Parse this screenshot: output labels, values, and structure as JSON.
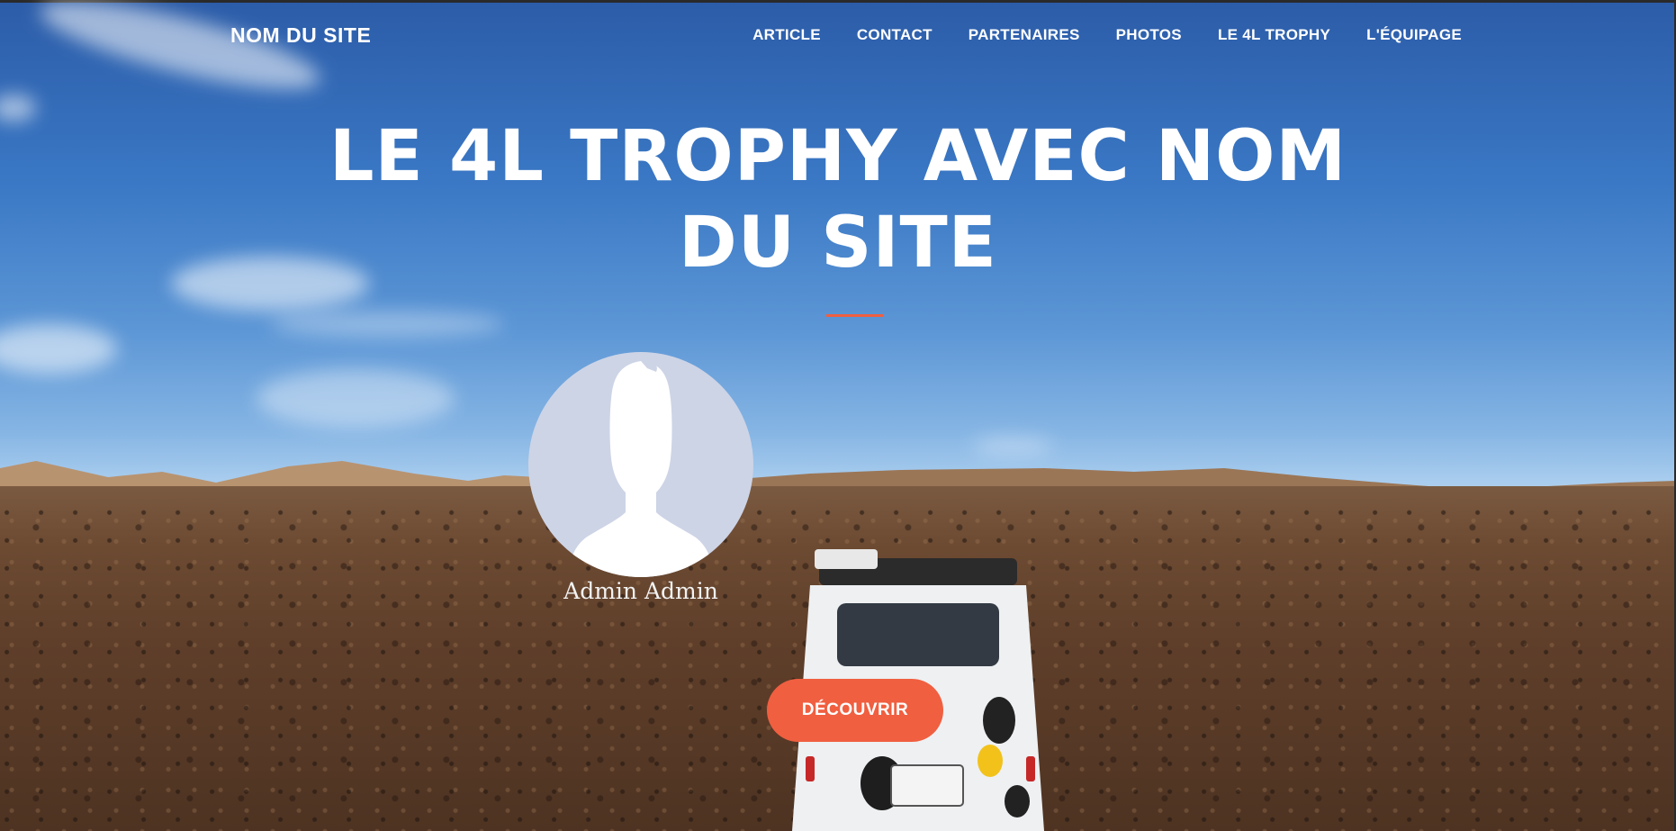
{
  "brand": "NOM DU SITE",
  "nav": {
    "items": [
      {
        "label": "ARTICLE"
      },
      {
        "label": "CONTACT"
      },
      {
        "label": "PARTENAIRES"
      },
      {
        "label": "PHOTOS"
      },
      {
        "label": "LE 4L TROPHY"
      },
      {
        "label": "L'ÉQUIPAGE"
      }
    ]
  },
  "hero": {
    "title": "LE 4L TROPHY AVEC NOM DU SITE",
    "author": "Admin Admin",
    "cta_label": "DÉCOUVRIR",
    "avatar_icon": "default-user-silhouette-icon"
  },
  "colors": {
    "accent": "#f05f40",
    "avatar_bg": "#cdd4e6",
    "text": "#ffffff"
  }
}
